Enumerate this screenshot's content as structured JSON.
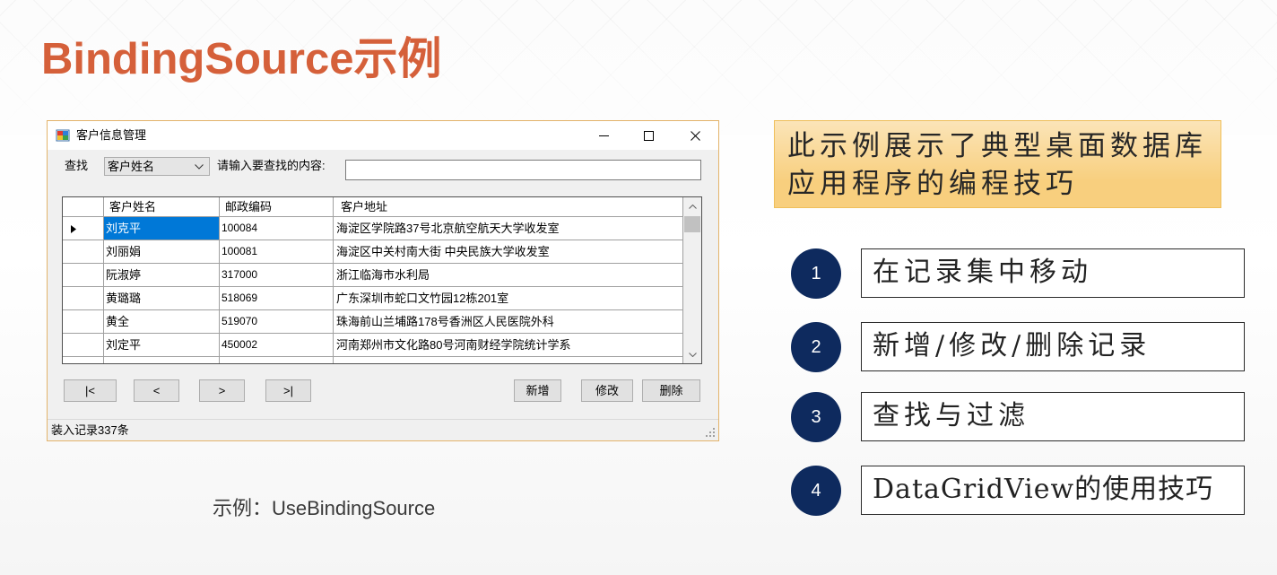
{
  "slide": {
    "title": "BindingSource示例",
    "caption": "示例：UseBindingSource",
    "callout_lines": [
      "此示例展示了典型桌面数据库",
      "应用程序的编程技巧"
    ],
    "steps": [
      {
        "number": "1",
        "label": "在记录集中移动"
      },
      {
        "number": "2",
        "label": "新增/修改/删除记录"
      },
      {
        "number": "3",
        "label": "查找与过滤"
      },
      {
        "number": "4",
        "label": "DataGridView的使用技巧"
      }
    ]
  },
  "window": {
    "title": "客户信息管理",
    "controls": {
      "minimize": "minimize-icon",
      "maximize": "maximize-icon",
      "close": "close-icon"
    },
    "search": {
      "label": "查找",
      "field_selected": "客户姓名",
      "prompt": "请输入要查找的内容:",
      "query": ""
    },
    "grid": {
      "columns": [
        "客户姓名",
        "邮政编码",
        "客户地址"
      ],
      "selected_cell": [
        0,
        0
      ],
      "rows": [
        [
          "刘克平",
          "100084",
          "海淀区学院路37号北京航空航天大学收发室"
        ],
        [
          "刘丽娟",
          "100081",
          "海淀区中关村南大街 中央民族大学收发室"
        ],
        [
          "阮淑婷",
          "317000",
          "浙江临海市水利局"
        ],
        [
          "黄璐璐",
          "518069",
          "广东深圳市蛇口文竹园12栋201室"
        ],
        [
          "黄全",
          "519070",
          "珠海前山兰埔路178号香洲区人民医院外科"
        ],
        [
          "刘定平",
          "450002",
          "河南郑州市文化路80号河南财经学院统计学系"
        ]
      ]
    },
    "navigation": {
      "first": "|<",
      "previous": "<",
      "next": ">",
      "last": ">|"
    },
    "actions": {
      "add": "新增",
      "edit": "修改",
      "delete": "删除"
    },
    "status": "装入记录337条"
  },
  "colors": {
    "title": "#d5603a",
    "selection": "#0078d7",
    "badge": "#0e2a5e",
    "callout_fill": "#f8cf7e"
  }
}
